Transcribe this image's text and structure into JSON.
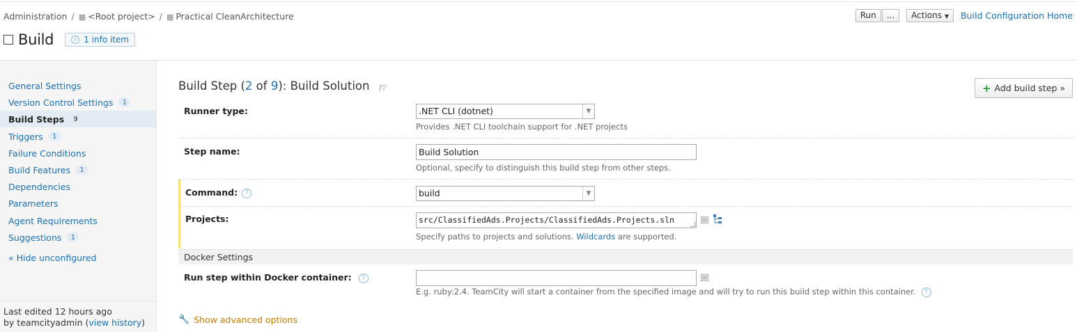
{
  "breadcrumb": {
    "items": [
      "Administration",
      "<Root project>",
      "Practical CleanArchitecture"
    ]
  },
  "header": {
    "run_label": "Run",
    "run_more_label": "...",
    "actions_label": "Actions",
    "home_link": "Build Configuration Home"
  },
  "page": {
    "title": "Build",
    "info_badge": "1 info item"
  },
  "sidebar": {
    "items": [
      {
        "label": "General Settings",
        "badge": ""
      },
      {
        "label": "Version Control Settings",
        "badge": "1"
      },
      {
        "label": "Build Steps",
        "badge": "9"
      },
      {
        "label": "Triggers",
        "badge": "1"
      },
      {
        "label": "Failure Conditions",
        "badge": ""
      },
      {
        "label": "Build Features",
        "badge": "1"
      },
      {
        "label": "Dependencies",
        "badge": ""
      },
      {
        "label": "Parameters",
        "badge": ""
      },
      {
        "label": "Agent Requirements",
        "badge": ""
      },
      {
        "label": "Suggestions",
        "badge": "1"
      }
    ],
    "hide_unconfigured": "« Hide unconfigured",
    "last_edited_label": "Last edited",
    "last_edited_time": "12 hours ago",
    "by_label": "by teamcityadmin",
    "view_history": "view history"
  },
  "step": {
    "title_prefix": "Build Step (",
    "current": "2",
    "of_label": " of ",
    "total": "9",
    "title_suffix": "): Build Solution",
    "add_button": "Add build step »"
  },
  "form": {
    "runner_type_label": "Runner type:",
    "runner_type_value": ".NET CLI (dotnet)",
    "runner_type_note": "Provides .NET CLI toolchain support for .NET projects",
    "step_name_label": "Step name:",
    "step_name_value": "Build Solution",
    "step_name_note": "Optional, specify to distinguish this build step from other steps.",
    "command_label": "Command:",
    "command_value": "build",
    "projects_label": "Projects:",
    "projects_value": "src/ClassifiedAds.Projects/ClassifiedAds.Projects.sln",
    "projects_note_prefix": "Specify paths to projects and solutions. ",
    "projects_note_link": "Wildcards",
    "projects_note_suffix": " are supported.",
    "docker_section": "Docker Settings",
    "docker_label": "Run step within Docker container:",
    "docker_value": "",
    "docker_note": "E.g. ruby:2.4. TeamCity will start a container from the specified image and will try to run this build step within this container.",
    "show_advanced": "Show advanced options"
  }
}
